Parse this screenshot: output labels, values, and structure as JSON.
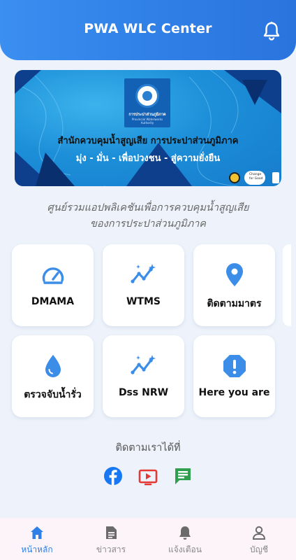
{
  "header": {
    "title": "PWA WLC Center",
    "bell_icon": "bell-icon"
  },
  "banner": {
    "logo_text_th": "การประปาส่วนภูมิภาค",
    "logo_text_en": "Provincial Waterworks Authority",
    "line1": "สำนักควบคุมน้ำสูญเสีย การประปาส่วนภูมิภาค",
    "line2": "มุ่ง - มั่น - เพื่อปวงชน - สู่ความยั่งยืน",
    "partner_text": "Change for Good"
  },
  "subtitle": {
    "line1": "ศูนย์รวมแอปพลิเคชันเพื่อการควบคุมน้ำสูญเสีย",
    "line2": "ของการประปาส่วนภูมิภาค"
  },
  "apps": [
    {
      "label": "DMAMA",
      "icon": "speedometer-icon"
    },
    {
      "label": "WTMS",
      "icon": "trend-sparkle-icon"
    },
    {
      "label": "ติดตามมาตร",
      "icon": "location-pin-icon"
    },
    {
      "label": "ตรวจจับน้ำรั่ว",
      "icon": "water-drop-icon"
    },
    {
      "label": "Dss NRW",
      "icon": "trend-sparkle-icon"
    },
    {
      "label": "Here you are",
      "icon": "alert-octagon-icon"
    }
  ],
  "follow": {
    "label": "ติดตามเราได้ที่"
  },
  "social": [
    {
      "name": "facebook-icon",
      "color": "#1877f2"
    },
    {
      "name": "youtube-tv-icon",
      "color": "#e53935"
    },
    {
      "name": "chat-icon",
      "color": "#2e9e4f"
    }
  ],
  "nav": [
    {
      "label": "หน้าหลัก",
      "icon": "home-icon",
      "active": true
    },
    {
      "label": "ข่าวสาร",
      "icon": "news-icon",
      "active": false
    },
    {
      "label": "แจ้งเตือน",
      "icon": "bell-icon",
      "active": false
    },
    {
      "label": "บัญชี",
      "icon": "person-icon",
      "active": false
    }
  ],
  "colors": {
    "primary": "#2f7fe6",
    "icon_blue": "#3b8de8",
    "background": "#eef3fb"
  }
}
